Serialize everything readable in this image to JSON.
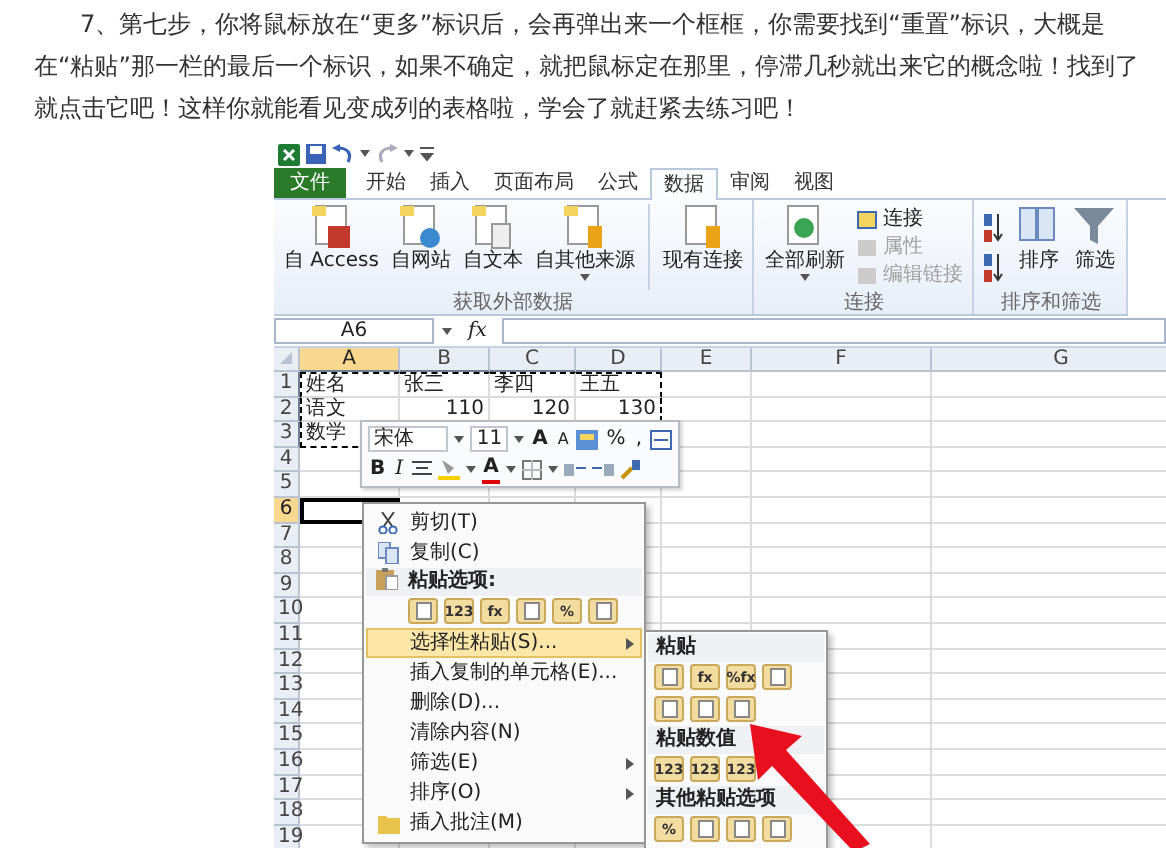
{
  "article": {
    "paragraph": "7、第七步，你将鼠标放在“更多”标识后，会再弹出来一个框框，你需要找到“重置”标识，大概是在“粘贴”那一栏的最后一个标识，如果不确定，就把鼠标定在那里，停滞几秒就出来它的概念啦！找到了就点击它吧！这样你就能看见变成列的表格啦，学会了就赶紧去练习吧！"
  },
  "excel": {
    "tabs": [
      {
        "label": "文件",
        "kind": "file",
        "selected": false
      },
      {
        "label": "开始",
        "kind": "tab",
        "selected": false
      },
      {
        "label": "插入",
        "kind": "tab",
        "selected": false
      },
      {
        "label": "页面布局",
        "kind": "tab",
        "selected": false
      },
      {
        "label": "公式",
        "kind": "tab",
        "selected": false
      },
      {
        "label": "数据",
        "kind": "tab",
        "selected": true
      },
      {
        "label": "审阅",
        "kind": "tab",
        "selected": false
      },
      {
        "label": "视图",
        "kind": "tab",
        "selected": false
      }
    ],
    "ribbon_groups": [
      {
        "label": "获取外部数据",
        "buttons": [
          {
            "kind": "large",
            "label": "自 Access",
            "disabled": false,
            "dropdown": false,
            "separator_before": false
          },
          {
            "kind": "large",
            "label": "自网站",
            "disabled": false,
            "dropdown": false,
            "separator_before": false
          },
          {
            "kind": "large",
            "label": "自文本",
            "disabled": false,
            "dropdown": false,
            "separator_before": false
          },
          {
            "kind": "large",
            "label": "自其他来源",
            "disabled": false,
            "dropdown": true,
            "separator_before": false
          },
          {
            "kind": "large",
            "label": "现有连接",
            "disabled": false,
            "dropdown": false,
            "separator_before": true
          }
        ]
      },
      {
        "label": "连接",
        "buttons": [
          {
            "kind": "large",
            "label": "全部刷新",
            "disabled": false,
            "dropdown": true,
            "separator_before": false
          },
          {
            "kind": "small",
            "label": "连接",
            "disabled": false
          },
          {
            "kind": "small",
            "label": "属性",
            "disabled": true
          },
          {
            "kind": "small",
            "label": "编辑链接",
            "disabled": true
          }
        ]
      },
      {
        "label": "排序和筛选",
        "buttons": [
          {
            "kind": "icon",
            "disabled": false
          },
          {
            "kind": "icon",
            "disabled": false
          },
          {
            "kind": "large",
            "label": "排序",
            "disabled": false,
            "dropdown": false,
            "separator_before": false
          },
          {
            "kind": "large",
            "label": "筛选",
            "disabled": false,
            "dropdown": false,
            "separator_before": false
          }
        ]
      }
    ],
    "formula_bar": {
      "name_box": "A6",
      "function_button": "fx"
    },
    "grid": {
      "columns": [
        {
          "label": "A",
          "selected": true,
          "copied": true
        },
        {
          "label": "B",
          "selected": false,
          "copied": true
        },
        {
          "label": "C",
          "selected": false,
          "copied": true
        },
        {
          "label": "D",
          "selected": false,
          "copied": true
        },
        {
          "label": "E",
          "selected": false,
          "copied": false
        },
        {
          "label": "F",
          "selected": false,
          "copied": false
        },
        {
          "label": "G",
          "selected": false,
          "copied": false
        }
      ],
      "rows": [
        {
          "label": "1",
          "selected": false,
          "copied": true,
          "cells": [
            {
              "text": "姓名",
              "kind": "text"
            },
            {
              "text": "张三",
              "kind": "text"
            },
            {
              "text": "李四",
              "kind": "text"
            },
            {
              "text": "王五",
              "kind": "text"
            }
          ]
        },
        {
          "label": "2",
          "selected": false,
          "copied": true,
          "cells": [
            {
              "text": "语文",
              "kind": "text"
            },
            {
              "text": "110",
              "kind": "number"
            },
            {
              "text": "120",
              "kind": "number"
            },
            {
              "text": "130",
              "kind": "number"
            }
          ]
        },
        {
          "label": "3",
          "selected": false,
          "copied": true,
          "cells": [
            {
              "text": "数学",
              "kind": "text"
            }
          ]
        },
        {
          "label": "4",
          "selected": false,
          "copied": false
        },
        {
          "label": "5",
          "selected": false,
          "copied": false
        },
        {
          "label": "6",
          "selected": true,
          "copied": false
        },
        {
          "label": "7",
          "selected": false,
          "copied": false
        },
        {
          "label": "8",
          "selected": false,
          "copied": false
        },
        {
          "label": "9",
          "selected": false,
          "copied": false
        },
        {
          "label": "10",
          "selected": false,
          "copied": false
        },
        {
          "label": "11",
          "selected": false,
          "copied": false
        },
        {
          "label": "12",
          "selected": false,
          "copied": false
        },
        {
          "label": "13",
          "selected": false,
          "copied": false
        },
        {
          "label": "14",
          "selected": false,
          "copied": false
        },
        {
          "label": "15",
          "selected": false,
          "copied": false
        },
        {
          "label": "16",
          "selected": false,
          "copied": false
        },
        {
          "label": "17",
          "selected": false,
          "copied": false
        },
        {
          "label": "18",
          "selected": false,
          "copied": false
        },
        {
          "label": "19",
          "selected": false,
          "copied": false
        }
      ]
    },
    "mini_toolbar": {
      "font": "宋体",
      "size": "11",
      "grow_font": "A",
      "shrink_font": "A",
      "percent": "%",
      "comma": ",",
      "bold": "B",
      "italic": "I",
      "font_color": "A"
    },
    "context_menu": [
      {
        "kind": "item",
        "label": "剪切(T)",
        "submenu": false,
        "selected": false
      },
      {
        "kind": "item",
        "label": "复制(C)",
        "submenu": false,
        "selected": false
      },
      {
        "kind": "header",
        "label": "粘贴选项:"
      },
      {
        "kind": "icons",
        "tiles": [
          {
            "kind": "plain"
          },
          {
            "kind": "label",
            "text": "123"
          },
          {
            "kind": "label",
            "text": "fx"
          },
          {
            "kind": "plain"
          },
          {
            "kind": "label",
            "text": "%"
          },
          {
            "kind": "plain"
          }
        ]
      },
      {
        "kind": "item",
        "label": "选择性粘贴(S)...",
        "submenu": true,
        "selected": true
      },
      {
        "kind": "item",
        "label": "插入复制的单元格(E)...",
        "submenu": false,
        "selected": false
      },
      {
        "kind": "item",
        "label": "删除(D)...",
        "submenu": false,
        "selected": false
      },
      {
        "kind": "item",
        "label": "清除内容(N)",
        "submenu": false,
        "selected": false
      },
      {
        "kind": "item",
        "label": "筛选(E)",
        "submenu": true,
        "selected": false
      },
      {
        "kind": "item",
        "label": "排序(O)",
        "submenu": true,
        "selected": false
      },
      {
        "kind": "item",
        "label": "插入批注(M)",
        "submenu": false,
        "selected": false
      }
    ],
    "submenu": [
      {
        "kind": "header",
        "label": "粘贴"
      },
      {
        "kind": "icons",
        "tiles": [
          {
            "kind": "plain"
          },
          {
            "kind": "label",
            "text": "fx"
          },
          {
            "kind": "label",
            "text": "%fx"
          },
          {
            "kind": "plain"
          }
        ]
      },
      {
        "kind": "icons",
        "tiles": [
          {
            "kind": "plain"
          },
          {
            "kind": "plain"
          },
          {
            "kind": "plain"
          }
        ]
      },
      {
        "kind": "header",
        "label": "粘贴数值"
      },
      {
        "kind": "icons",
        "tiles": [
          {
            "kind": "label",
            "text": "123"
          },
          {
            "kind": "label",
            "text": "123"
          },
          {
            "kind": "label",
            "text": "123"
          }
        ]
      },
      {
        "kind": "header",
        "label": "其他粘贴选项"
      },
      {
        "kind": "icons",
        "tiles": [
          {
            "kind": "label",
            "text": "%"
          },
          {
            "kind": "plain"
          },
          {
            "kind": "plain"
          },
          {
            "kind": "plain"
          }
        ]
      }
    ]
  }
}
